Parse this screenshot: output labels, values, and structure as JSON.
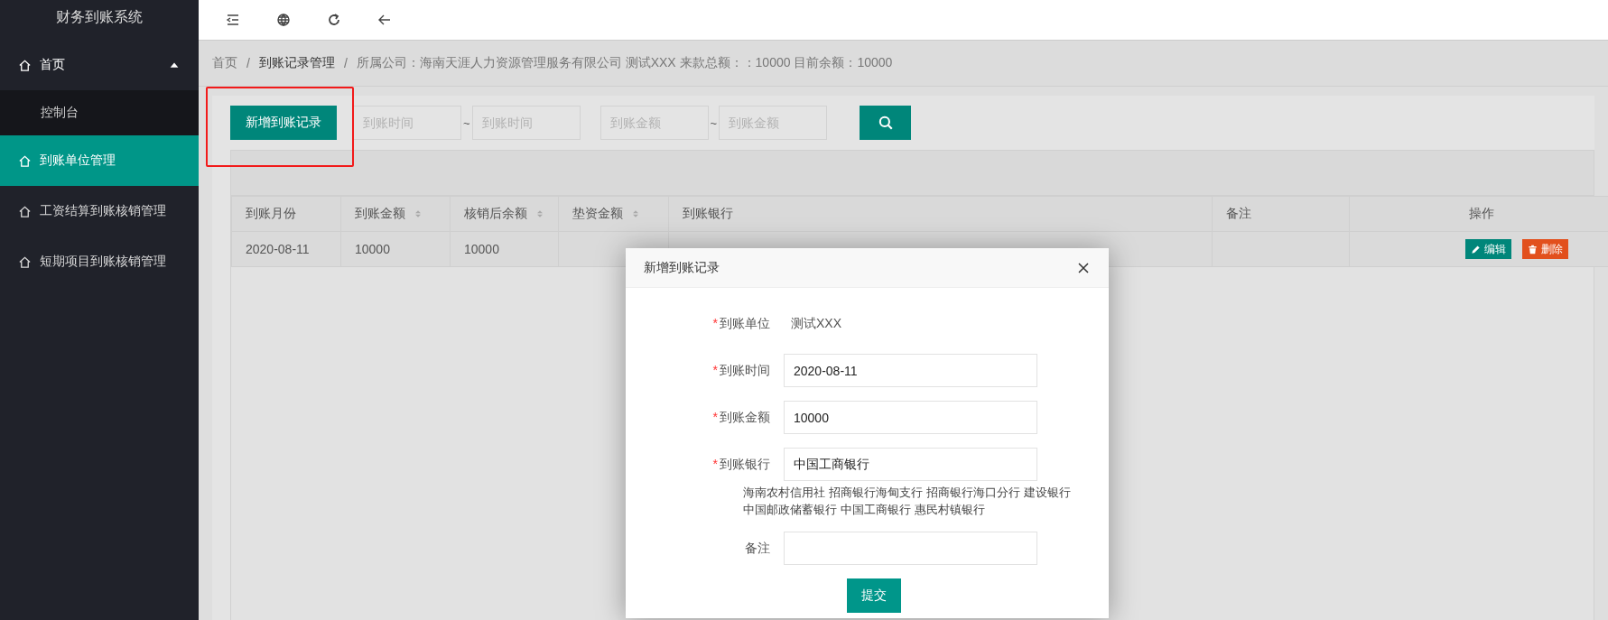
{
  "app": {
    "title": "财务到账系统"
  },
  "sidebar": {
    "items": [
      {
        "label": "首页",
        "selected": false,
        "expanded": true,
        "children": [
          {
            "label": "控制台",
            "selected": false
          }
        ]
      },
      {
        "label": "到账单位管理",
        "selected": true
      },
      {
        "label": "工资结算到账核销管理",
        "selected": false
      },
      {
        "label": "短期项目到账核销管理",
        "selected": false
      }
    ]
  },
  "breadcrumb": [
    {
      "label": "首页",
      "selected": false,
      "separator": "/"
    },
    {
      "label": "到账记录管理",
      "selected": true,
      "separator": "/"
    },
    {
      "label": "所属公司：海南天涯人力资源管理服务有限公司 测试XXX 来款总额：：10000 目前余额：10000",
      "selected": false
    }
  ],
  "toolbar": {
    "add_button": {
      "label": "新增到账记录",
      "highlighted": true
    },
    "ranges": [
      {
        "from": {
          "placeholder": "到账时间"
        },
        "separator": "~",
        "to": {
          "placeholder": "到账时间"
        }
      },
      {
        "from": {
          "placeholder": "到账金额"
        },
        "separator": "~",
        "to": {
          "placeholder": "到账金额"
        }
      }
    ]
  },
  "table": {
    "columns": [
      {
        "label": "到账月份",
        "sortable": false
      },
      {
        "label": "到账金额",
        "sortable": true
      },
      {
        "label": "核销后余额",
        "sortable": true
      },
      {
        "label": "垫资金额",
        "sortable": true
      },
      {
        "label": "到账银行",
        "sortable": false
      },
      {
        "label": "备注",
        "sortable": false
      },
      {
        "label": "操作",
        "sortable": false
      }
    ],
    "rows": [
      {
        "month": "2020-08-11",
        "amount": "10000",
        "balance": "10000",
        "actions": [
          {
            "label": "编辑",
            "kind": "edit"
          },
          {
            "label": "删除",
            "kind": "delete"
          }
        ]
      }
    ]
  },
  "dialog": {
    "title": "新增到账记录",
    "fields": [
      {
        "label": "到账单位",
        "required_mark": "*",
        "kind": "text",
        "value": "测试XXX"
      },
      {
        "label": "到账时间",
        "required_mark": "*",
        "kind": "input",
        "value": "2020-08-11"
      },
      {
        "label": "到账金额",
        "required_mark": "*",
        "kind": "input",
        "value": "10000"
      },
      {
        "label": "到账银行",
        "required_mark": "*",
        "kind": "input",
        "value": "中国工商银行",
        "options": [
          "海南农村信用社",
          "招商银行海甸支行",
          "招商银行海口分行",
          "建设银行",
          "中国邮政储蓄银行",
          "中国工商银行",
          "惠民村镇银行"
        ]
      },
      {
        "label": "备注",
        "kind": "input"
      }
    ],
    "submit": "提交"
  }
}
